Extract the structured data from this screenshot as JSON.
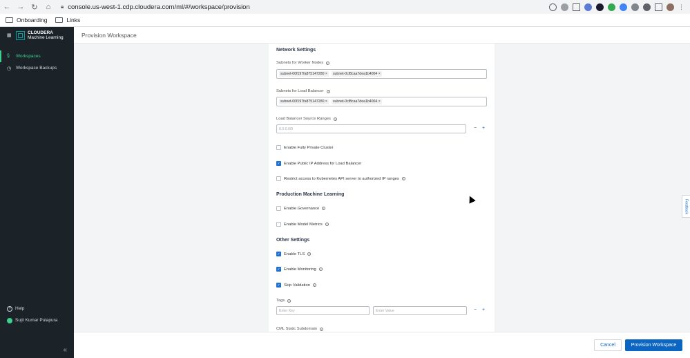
{
  "browser": {
    "url": "console.us-west-1.cdp.cloudera.com/ml/#/workspace/provision",
    "bookmarks": [
      "Onboarding",
      "Links"
    ]
  },
  "sidebar": {
    "brand_line1": "CLOUDERA",
    "brand_line2": "Machine Learning",
    "items": [
      {
        "label": "Workspaces",
        "active": true,
        "icon": "workspaces-icon"
      },
      {
        "label": "Workspace Backups",
        "active": false,
        "icon": "history-icon"
      }
    ],
    "help": "Help",
    "user": "Sujit Kumar Pulapura",
    "accent_color": "#3ecf8e"
  },
  "page": {
    "title": "Provision Workspace"
  },
  "form": {
    "network_settings": "Network Settings",
    "subnets_worker_label": "Subnets for Worker Nodes",
    "subnets_worker": [
      "subnet-00f197fa875147280",
      "subnet-0cf8caa7dea1b4004"
    ],
    "subnets_lb_label": "Subnets for Load Balancer",
    "subnets_lb": [
      "subnet-00f197fa875147280",
      "subnet-0cf8caa7dea1b4004"
    ],
    "lb_source_label": "Load Balancer Source Ranges",
    "lb_source_placeholder": "0.0.0.0/0",
    "private_cluster": {
      "label": "Enable Fully Private Cluster",
      "checked": false
    },
    "public_ip": {
      "label": "Enable Public IP Address for Load Balancer",
      "checked": true
    },
    "restrict_access": {
      "label": "Restrict access to Kubernetes API server to authorized IP ranges",
      "checked": false
    },
    "production_ml": "Production Machine Learning",
    "governance": {
      "label": "Enable Governance",
      "checked": false
    },
    "model_metrics": {
      "label": "Enable Model Metrics",
      "checked": false
    },
    "other_settings": "Other Settings",
    "tls": {
      "label": "Enable TLS",
      "checked": true
    },
    "monitoring": {
      "label": "Enable Monitoring",
      "checked": true
    },
    "skip_validation": {
      "label": "Skip Validation",
      "checked": true
    },
    "tags_label": "Tags",
    "tag_key_placeholder": "Enter Key",
    "tag_value_placeholder": "Enter Value",
    "static_subdomain_label": "CML Static Subdomain",
    "minus": "−",
    "plus": "+"
  },
  "footer": {
    "cancel": "Cancel",
    "provision": "Provision Workspace"
  },
  "feedback": "Feedback",
  "colors": {
    "primary": "#0a66c2",
    "sidebar_bg": "#1b2329"
  }
}
